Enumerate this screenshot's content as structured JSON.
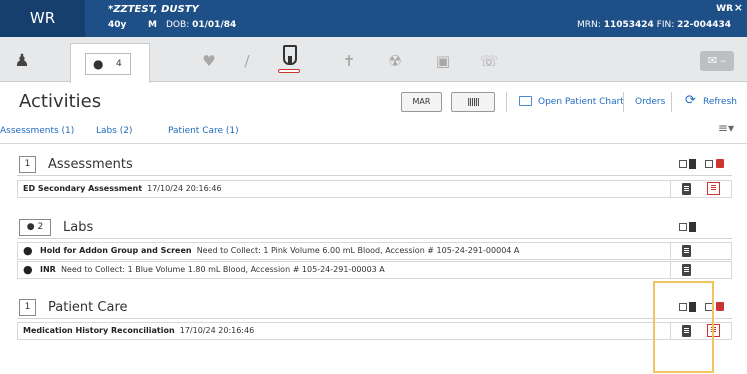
{
  "banner": {
    "logo": "WR",
    "patient_name": "*ZZTEST, DUSTY",
    "age": "40y",
    "sex": "M",
    "dob_label": "DOB:",
    "dob_value": "01/01/84",
    "right_label": "WR",
    "close": "×",
    "mrn_label": "MRN:",
    "mrn_value": "11053424",
    "fin_label": "FIN:",
    "fin_value": "22-004434"
  },
  "toolbar": {
    "tab_count": "4",
    "icons": [
      "person-icon",
      "drop-icon",
      "heart-icon",
      "bandage-icon",
      "tube-icon",
      "plane-icon",
      "radiation-icon",
      "camera-icon",
      "phone-icon",
      "message-icon"
    ]
  },
  "activities": {
    "title": "Activities",
    "mar_button": "MAR",
    "barcode_button": "||||||",
    "open_chart": "Open Patient Chart",
    "orders": "Orders",
    "refresh": "Refresh"
  },
  "filters": [
    {
      "label": "Assessments (1)"
    },
    {
      "label": "Labs (2)"
    },
    {
      "label": "Patient Care (1)"
    }
  ],
  "sections": {
    "assessments": {
      "count": "1",
      "title": "Assessments",
      "rows": [
        {
          "name": "ED Secondary Assessment",
          "detail": "17/10/24 20:16:46"
        }
      ]
    },
    "labs": {
      "count": "2",
      "title": "Labs",
      "rows": [
        {
          "name": "Hold for Addon Group and Screen",
          "detail": "Need to Collect: 1 Pink Volume 6.00 mL Blood, Accession # 105-24-291-00004 A"
        },
        {
          "name": "INR",
          "detail": "Need to Collect: 1 Blue Volume 1.80 mL Blood, Accession # 105-24-291-00003 A"
        }
      ]
    },
    "patient_care": {
      "count": "1",
      "title": "Patient Care",
      "rows": [
        {
          "name": "Medication History Reconciliation",
          "detail": "17/10/24 20:16:46"
        }
      ]
    }
  },
  "colors": {
    "banner": "#1f4f87",
    "link": "#1f6bbf",
    "highlight": "#f2c45d"
  }
}
